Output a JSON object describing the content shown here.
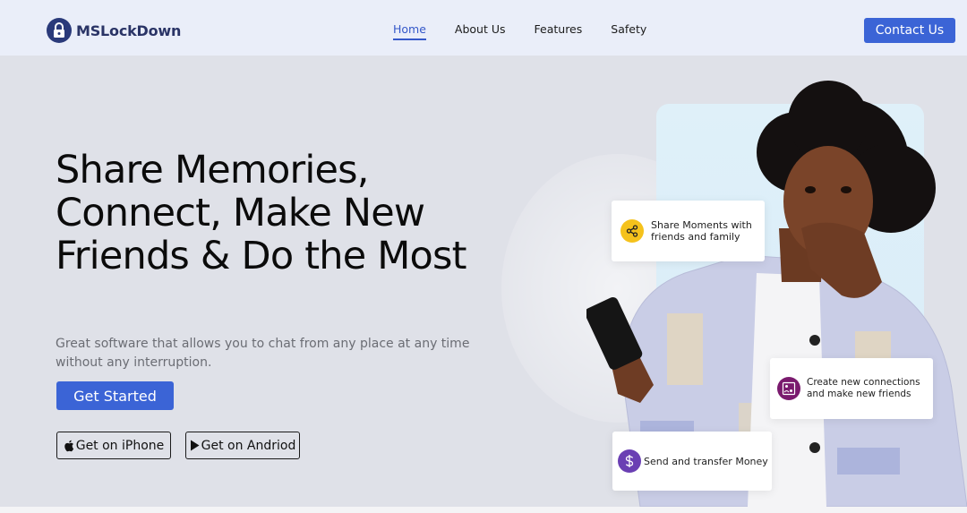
{
  "brand": {
    "name": "MSLockDown",
    "icon": "lock-icon"
  },
  "nav": {
    "links": [
      {
        "label": "Home",
        "active": true
      },
      {
        "label": "About Us",
        "active": false
      },
      {
        "label": "Features",
        "active": false
      },
      {
        "label": "Safety",
        "active": false
      }
    ],
    "contact_label": "Contact Us"
  },
  "hero": {
    "title": "Share Memories, Connect, Make New Friends & Do the Most",
    "subtitle": "Great software that allows you to chat from any place at any time without any interruption.",
    "cta_label": "Get Started",
    "iphone_label": "Get on iPhone",
    "android_label": "Get on Andriod"
  },
  "feature_cards": [
    {
      "text": "Share Moments with friends and family",
      "icon": "share-icon",
      "color": "#f5c21c"
    },
    {
      "text": "Create new connections and make new friends",
      "icon": "connections-icon",
      "color": "#7a1a6e"
    },
    {
      "text": "Send and transfer Money",
      "icon": "dollar-icon",
      "color": "#6a3fb3"
    }
  ],
  "colors": {
    "accent": "#3b64d6",
    "nav_bg": "#eaeef9",
    "hero_bg": "#dfe1e8"
  }
}
